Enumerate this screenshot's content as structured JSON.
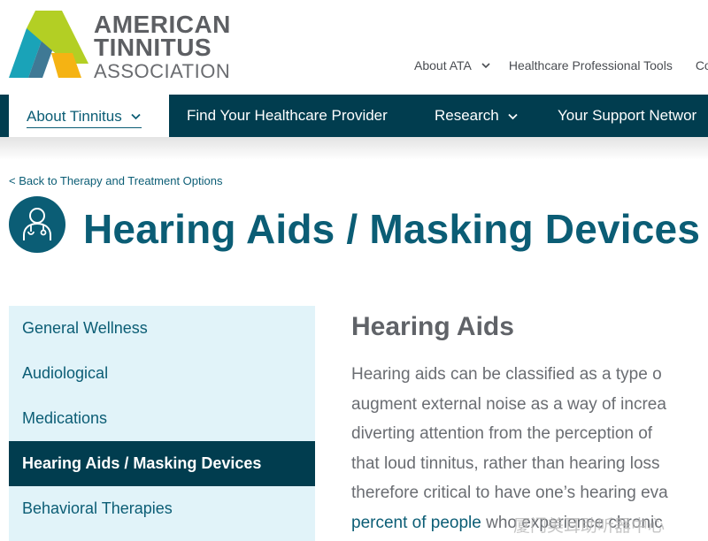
{
  "logo": {
    "line1": "AMERICAN",
    "line2": "TINNITUS",
    "line3": "ASSOCIATION",
    "colors": {
      "teal": "#1aa3b8",
      "green": "#b3cf24",
      "yellow": "#f5b313",
      "dark": "#2a6a8a"
    }
  },
  "utility_nav": {
    "items": [
      {
        "label": "About ATA",
        "icon": "chevron-down-icon"
      },
      {
        "label": "Healthcare Professional Tools"
      },
      {
        "label": "Co"
      }
    ]
  },
  "main_nav": {
    "items": [
      {
        "label": "About Tinnitus",
        "icon": "chevron-down-icon",
        "active": true
      },
      {
        "label": "Find Your Healthcare Provider"
      },
      {
        "label": "Research",
        "icon": "chevron-down-icon"
      },
      {
        "label": "Your Support Networ"
      }
    ]
  },
  "breadcrumb": {
    "back_label": "< Back to Therapy and Treatment Options"
  },
  "page": {
    "title": "Hearing Aids / Masking Devices",
    "title_icon": "doctor-icon"
  },
  "sidebar": {
    "items": [
      {
        "label": "General Wellness"
      },
      {
        "label": "Audiological"
      },
      {
        "label": "Medications"
      },
      {
        "label": "Hearing Aids / Masking Devices",
        "active": true
      },
      {
        "label": "Behavioral Therapies"
      }
    ]
  },
  "content": {
    "heading": "Hearing Aids",
    "lines": [
      "Hearing aids can be classified as a type o",
      "augment external noise as a way of increa",
      "diverting attention from the perception of",
      "that loud tinnitus, rather than hearing loss",
      "therefore critical to have one’s hearing eva"
    ],
    "last_line_link": "percent of people",
    "last_line_rest": " who experience chronic"
  },
  "watermark": {
    "text": "厦门美耳助听器中心"
  },
  "colors": {
    "brand_dark": "#013d4f",
    "brand_teal": "#0b5d75",
    "sidebar_bg": "#e1f3f9",
    "heading_gray": "#606368"
  }
}
